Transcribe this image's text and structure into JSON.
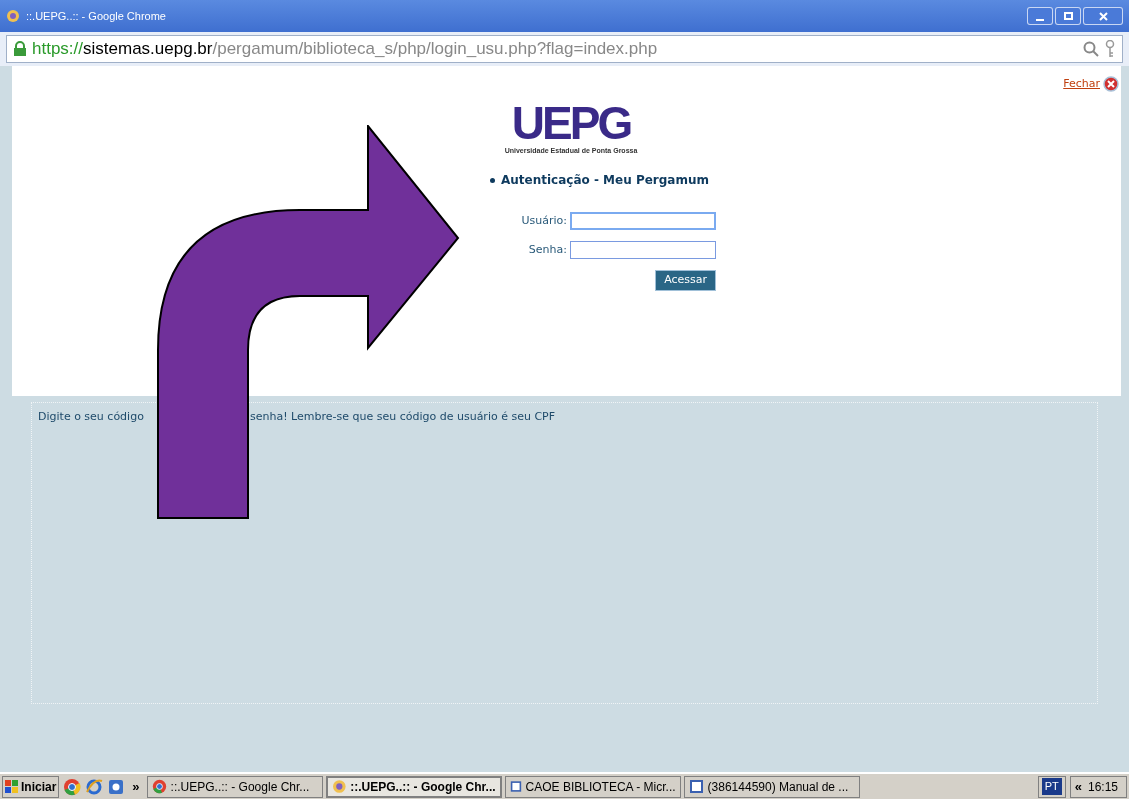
{
  "window": {
    "title": "::.UEPG..:: - Google Chrome"
  },
  "address_bar": {
    "scheme": "https://",
    "host": "sistemas.uepg.br",
    "path": "/pergamum/biblioteca_s/php/login_usu.php?flag=index.php"
  },
  "close_link": "Fechar",
  "logo": {
    "letters": "UEPG",
    "subtitle": "Universidade Estadual de Ponta Grossa"
  },
  "heading": "Autenticação - Meu Pergamum",
  "fields": [
    {
      "label": "Usuário:",
      "focused": true
    },
    {
      "label": "Senha:",
      "focused": false
    }
  ],
  "submit": "Acessar",
  "hint": [
    "Digite o seu código",
    "senha! Lembre-se que seu código de usuário é seu CPF"
  ],
  "taskbar": {
    "start": "Iniciar",
    "more": "»",
    "tasks": [
      {
        "label": "::.UEPG..:: - Google Chr...",
        "kind": "chrome",
        "selected": false
      },
      {
        "label": "::.UEPG..:: - Google Chr...",
        "kind": "sun",
        "selected": true
      },
      {
        "label": "CAOE BIBLIOTECA - Micr...",
        "kind": "doc",
        "selected": false
      },
      {
        "label": "(386144590) Manual de ...",
        "kind": "doc",
        "selected": false
      }
    ],
    "language": "PT",
    "chevron": "«",
    "clock": "16:15"
  }
}
